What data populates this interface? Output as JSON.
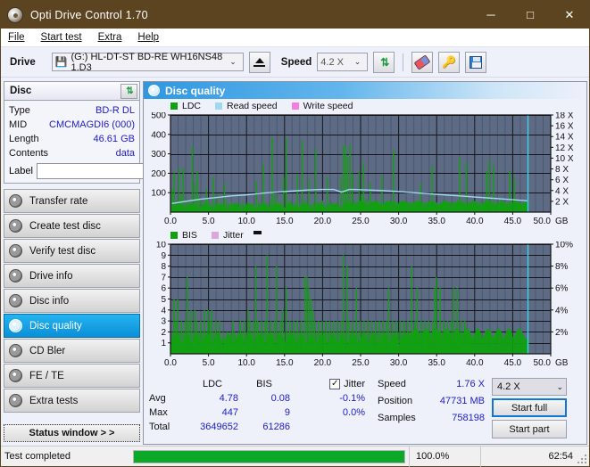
{
  "window": {
    "title": "Opti Drive Control 1.70",
    "icon": "disc-icon",
    "minimize": "─",
    "maximize": "□",
    "close": "✕"
  },
  "menu": {
    "items": [
      "File",
      "Start test",
      "Extra",
      "Help"
    ]
  },
  "toolbar": {
    "drive_label": "Drive",
    "drive_value": "(G:)  HL-DT-ST BD-RE  WH16NS48 1.D3",
    "eject_title": "Eject",
    "speed_label": "Speed",
    "speed_value": "4.2 X",
    "caret": "⌄",
    "icons": [
      "refresh-icon",
      "eraser-icon",
      "keys-icon",
      "save-icon"
    ]
  },
  "disc": {
    "title": "Disc",
    "refresh_icon": "refresh-icon",
    "rows": [
      {
        "key": "Type",
        "value": "BD-R DL"
      },
      {
        "key": "MID",
        "value": "CMCMAGDI6 (000)"
      },
      {
        "key": "Length",
        "value": "46.61 GB"
      },
      {
        "key": "Contents",
        "value": "data"
      }
    ],
    "label_key": "Label",
    "label_value": "",
    "label_placeholder": ""
  },
  "sidebar": {
    "items": [
      {
        "label": "Transfer rate",
        "active": false
      },
      {
        "label": "Create test disc",
        "active": false
      },
      {
        "label": "Verify test disc",
        "active": false
      },
      {
        "label": "Drive info",
        "active": false
      },
      {
        "label": "Disc info",
        "active": false
      },
      {
        "label": "Disc quality",
        "active": true
      },
      {
        "label": "CD Bler",
        "active": false
      },
      {
        "label": "FE / TE",
        "active": false
      },
      {
        "label": "Extra tests",
        "active": false
      }
    ],
    "status_button": "Status window > >"
  },
  "panel": {
    "title": "Disc quality",
    "icon": "disc-icon"
  },
  "chart_data": [
    {
      "type": "bar",
      "name": "ldc-chart",
      "title": "",
      "xlabel": "GB",
      "ylabel": "",
      "legend": [
        {
          "label": "LDC",
          "color": "#11a011"
        },
        {
          "label": "Read speed",
          "color": "#9fd8f2"
        },
        {
          "label": "Write speed",
          "color": "#f57ce0"
        }
      ],
      "legend_position": "top-left",
      "grid": true,
      "plot_bg": "#5e6b84",
      "xlim": [
        0,
        50
      ],
      "xticks": [
        "0.0",
        "5.0",
        "10.0",
        "15.0",
        "20.0",
        "25.0",
        "30.0",
        "35.0",
        "40.0",
        "45.0",
        "50.0"
      ],
      "x_unit": "GB",
      "ylim": [
        0,
        500
      ],
      "yticks": [
        100,
        200,
        300,
        400,
        500
      ],
      "y2lim": [
        0,
        18
      ],
      "y2ticks": [
        "2 X",
        "4 X",
        "6 X",
        "8 X",
        "10 X",
        "12 X",
        "14 X",
        "16 X",
        "18 X"
      ],
      "data_end_gb": 46.9,
      "cursor_gb": 46.9,
      "cursor_color": "#3fd0f5",
      "series": [
        {
          "name": "LDC",
          "color": "#11a011",
          "x": [
            0.2,
            0.5,
            0.8,
            1.1,
            1.4,
            1.7,
            2.0,
            2.3,
            2.6,
            2.9,
            3.2,
            3.5,
            3.8,
            4.1,
            4.4,
            4.7,
            5.0,
            5.3,
            5.6,
            5.9,
            6.2,
            6.5,
            6.8,
            7.1,
            7.4,
            7.7,
            8.0,
            8.3,
            8.6,
            8.9,
            9.2,
            9.5,
            9.8,
            10.1,
            10.4,
            10.7,
            11.0,
            11.3,
            11.6,
            11.9,
            12.2,
            12.5,
            12.8,
            13.1,
            13.4,
            13.7,
            14.0,
            14.3,
            14.6,
            14.9,
            15.2,
            15.5,
            15.8,
            16.1,
            16.4,
            16.7,
            17.0,
            17.3,
            17.6,
            17.9,
            18.2,
            18.5,
            18.8,
            19.1,
            19.4,
            19.7,
            20.0,
            20.3,
            20.6,
            20.9,
            21.2,
            21.5,
            21.8,
            22.1,
            22.4,
            22.7,
            23.0,
            23.3,
            23.6,
            23.9,
            24.2,
            24.5,
            24.8,
            25.1,
            25.4,
            25.7,
            26.0,
            26.3,
            26.6,
            26.9,
            27.2,
            27.5,
            27.8,
            28.1,
            28.4,
            28.7,
            29.0,
            29.3,
            29.6,
            29.9,
            30.2,
            30.5,
            30.8,
            31.1,
            31.4,
            31.7,
            32.0,
            32.3,
            32.6,
            32.9,
            33.2,
            33.5,
            33.8,
            34.1,
            34.4,
            34.7,
            35.0,
            35.3,
            35.6,
            35.9,
            36.2,
            36.5,
            36.8,
            37.1,
            37.4,
            37.7,
            38.0,
            38.3,
            38.6,
            38.9,
            39.2,
            39.5,
            39.8,
            40.1,
            40.4,
            40.7,
            41.0,
            41.3,
            41.6,
            41.9,
            42.2,
            42.5,
            42.8,
            43.1,
            43.4,
            43.7,
            44.0,
            44.3,
            44.6,
            44.9,
            45.2,
            45.5,
            45.8,
            46.1,
            46.4,
            46.7
          ],
          "values": [
            120,
            200,
            60,
            230,
            90,
            225,
            55,
            70,
            45,
            340,
            150,
            210,
            80,
            60,
            55,
            120,
            65,
            40,
            180,
            50,
            95,
            35,
            45,
            150,
            60,
            40,
            55,
            35,
            50,
            45,
            40,
            60,
            35,
            50,
            40,
            45,
            35,
            160,
            55,
            40,
            250,
            50,
            45,
            60,
            385,
            95,
            70,
            50,
            45,
            180,
            380,
            55,
            60,
            40,
            50,
            195,
            45,
            370,
            60,
            50,
            175,
            40,
            45,
            325,
            55,
            50,
            60,
            45,
            180,
            40,
            55,
            35,
            50,
            45,
            180,
            345,
            340,
            280,
            350,
            200,
            60,
            50,
            215,
            90,
            255,
            70,
            60,
            150,
            55,
            45,
            60,
            40,
            190,
            50,
            45,
            60,
            40,
            320,
            55,
            50,
            45,
            60,
            40,
            50,
            55,
            45,
            50,
            40,
            45,
            150,
            55,
            50,
            40,
            45,
            240,
            55,
            50,
            40,
            45,
            60,
            50,
            45,
            40,
            55,
            50,
            45,
            280,
            60,
            50,
            255,
            45,
            40,
            55,
            50,
            45,
            60,
            40,
            50,
            210,
            270,
            55,
            240,
            45,
            50,
            60,
            40,
            50,
            45,
            215,
            55,
            180,
            50,
            45,
            40,
            60,
            50
          ]
        },
        {
          "name": "Read speed",
          "color": "#9fd8f2",
          "x": [
            0.2,
            2.0,
            4.0,
            6.0,
            8.0,
            10.0,
            12.0,
            14.0,
            16.0,
            18.0,
            20.0,
            21.5,
            22.5,
            23.5,
            24.0,
            26.0,
            28.0,
            30.0,
            32.0,
            34.0,
            36.0,
            38.0,
            40.0,
            42.0,
            44.0,
            46.0,
            46.9
          ],
          "values_x": [
            1.6,
            2.0,
            2.4,
            2.7,
            3.0,
            3.2,
            3.5,
            3.7,
            3.9,
            4.1,
            4.2,
            4.2,
            3.7,
            4.2,
            4.2,
            4.1,
            4.0,
            3.8,
            3.6,
            3.4,
            3.2,
            3.0,
            2.8,
            2.6,
            2.4,
            2.2,
            2.1
          ]
        }
      ]
    },
    {
      "type": "bar",
      "name": "bis-chart",
      "title": "",
      "xlabel": "GB",
      "ylabel": "",
      "legend": [
        {
          "label": "BIS",
          "color": "#11a011"
        },
        {
          "label": "Jitter",
          "color": "#d8a8dc"
        }
      ],
      "legend_position": "top-left",
      "grid": true,
      "plot_bg": "#5e6b84",
      "xlim": [
        0,
        50
      ],
      "xticks": [
        "0.0",
        "5.0",
        "10.0",
        "15.0",
        "20.0",
        "25.0",
        "30.0",
        "35.0",
        "40.0",
        "45.0",
        "50.0"
      ],
      "x_unit": "GB",
      "ylim": [
        0,
        10
      ],
      "yticks": [
        1,
        2,
        3,
        4,
        5,
        6,
        7,
        8,
        9,
        10
      ],
      "y2lim": [
        0,
        10
      ],
      "y2ticks": [
        "2%",
        "4%",
        "6%",
        "8%",
        "10%"
      ],
      "data_end_gb": 46.9,
      "cursor_gb": 46.9,
      "cursor_color": "#3fd0f5",
      "series": [
        {
          "name": "BIS",
          "color": "#11a011",
          "x": [
            0.2,
            0.45,
            0.7,
            0.95,
            1.2,
            1.45,
            1.7,
            1.95,
            2.2,
            2.45,
            2.7,
            2.95,
            3.2,
            3.45,
            3.7,
            3.95,
            4.2,
            4.45,
            4.7,
            4.95,
            5.2,
            5.45,
            5.7,
            5.95,
            6.2,
            6.45,
            6.7,
            6.95,
            7.2,
            7.45,
            7.7,
            7.95,
            8.2,
            8.45,
            8.7,
            8.95,
            9.2,
            9.45,
            9.7,
            9.95,
            10.2,
            10.45,
            10.7,
            10.95,
            11.2,
            11.45,
            11.7,
            11.95,
            12.2,
            12.45,
            12.7,
            12.95,
            13.2,
            13.45,
            13.7,
            13.95,
            14.2,
            14.45,
            14.7,
            14.95,
            15.2,
            15.45,
            15.7,
            15.95,
            16.2,
            16.45,
            16.7,
            16.95,
            17.2,
            17.45,
            17.7,
            17.95,
            18.2,
            18.45,
            18.7,
            18.95,
            19.2,
            19.45,
            19.7,
            19.95,
            20.2,
            20.45,
            20.7,
            20.95,
            21.2,
            21.45,
            21.7,
            21.95,
            22.2,
            22.45,
            22.7,
            22.95,
            23.2,
            23.45,
            23.7,
            23.95,
            24.2,
            24.45,
            24.7,
            24.95,
            25.2,
            25.45,
            25.7,
            25.95,
            26.2,
            26.45,
            26.7,
            26.95,
            27.2,
            27.45,
            27.7,
            27.95,
            28.2,
            28.45,
            28.7,
            28.95,
            29.2,
            29.45,
            29.7,
            29.95,
            30.2,
            30.45,
            30.7,
            30.95,
            31.2,
            31.45,
            31.7,
            31.95,
            32.2,
            32.45,
            32.7,
            32.95,
            33.2,
            33.45,
            33.7,
            33.95,
            34.2,
            34.45,
            34.7,
            34.95,
            35.2,
            35.45,
            35.7,
            35.95,
            36.2,
            36.45,
            36.7,
            36.95,
            37.2,
            37.45,
            37.7,
            37.95,
            38.2,
            38.45,
            38.7,
            38.95,
            39.2,
            39.45,
            39.7,
            39.95,
            40.2,
            40.45,
            40.7,
            40.95,
            41.2,
            41.45,
            41.7,
            41.95,
            42.2,
            42.45,
            42.7,
            42.95,
            43.2,
            43.45,
            43.7,
            43.95,
            44.2,
            44.45,
            44.7,
            44.95,
            45.2,
            45.45,
            45.7,
            45.95,
            46.2,
            46.45,
            46.7
          ],
          "values": [
            2,
            5,
            3,
            5,
            2,
            3,
            2,
            3,
            7,
            3,
            4,
            2,
            4,
            3,
            2,
            3,
            2,
            4,
            2,
            4,
            3,
            4,
            2,
            3,
            2,
            3,
            1,
            2,
            1,
            2,
            1,
            2,
            3,
            2,
            1,
            2,
            3,
            2,
            3,
            2,
            4,
            3,
            2,
            3,
            8,
            3,
            2,
            3,
            2,
            3,
            9,
            2,
            3,
            2,
            3,
            8,
            2,
            3,
            4,
            2,
            6,
            2,
            3,
            2,
            3,
            2,
            3,
            2,
            3,
            2,
            7,
            7,
            6,
            5,
            4,
            3,
            2,
            3,
            2,
            3,
            2,
            3,
            2,
            3,
            2,
            3,
            2,
            3,
            2,
            3,
            9,
            2,
            8,
            3,
            2,
            3,
            2,
            6,
            2,
            3,
            2,
            3,
            2,
            3,
            2,
            3,
            2,
            3,
            2,
            3,
            2,
            3,
            2,
            3,
            6,
            2,
            3,
            2,
            3,
            2,
            3,
            2,
            3,
            2,
            3,
            2,
            8,
            2,
            3,
            6,
            2,
            3,
            2,
            3,
            2,
            3,
            2,
            3,
            6,
            7,
            2,
            6,
            2,
            3,
            2,
            3,
            2,
            3,
            6,
            2,
            6,
            2,
            3,
            2,
            3,
            2
          ]
        }
      ]
    }
  ],
  "stats": {
    "col_headers": [
      "LDC",
      "BIS"
    ],
    "jitter_label": "Jitter",
    "jitter_checked": true,
    "rows": [
      {
        "key": "Avg",
        "ldc": "4.78",
        "bis": "0.08",
        "jitter": "-0.1%"
      },
      {
        "key": "Max",
        "ldc": "447",
        "bis": "9",
        "jitter": "0.0%"
      },
      {
        "key": "Total",
        "ldc": "3649652",
        "bis": "61286",
        "jitter": ""
      }
    ],
    "right": [
      {
        "key": "Speed",
        "value": "1.76 X"
      },
      {
        "key": "Position",
        "value": "47731 MB"
      },
      {
        "key": "Samples",
        "value": "758198"
      }
    ],
    "speed_select": "4.2 X",
    "caret": "⌄",
    "start_full": "Start full",
    "start_part": "Start part"
  },
  "statusbar": {
    "text": "Test completed",
    "progress_pct": "100.0%",
    "progress_value": 100,
    "elapsed": "62:54"
  }
}
